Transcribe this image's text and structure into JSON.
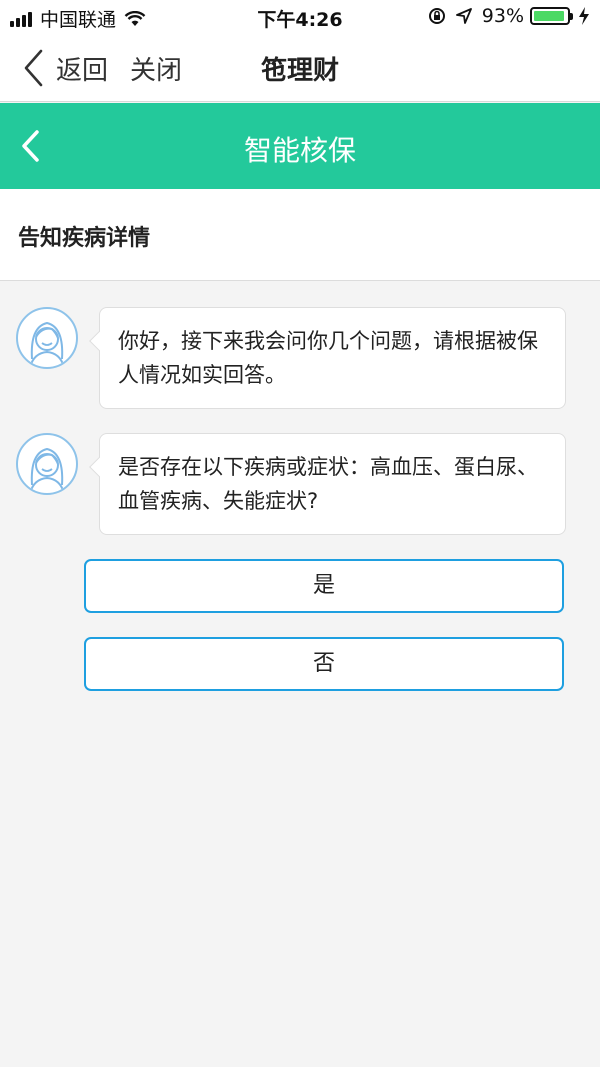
{
  "status_bar": {
    "carrier": "中国联通",
    "time": "下午4:26",
    "battery_percent": "93%",
    "battery_level": 0.93,
    "icons": [
      "signal-icon",
      "wifi-icon",
      "rotation-lock-icon",
      "location-icon",
      "battery-icon",
      "charging-icon"
    ]
  },
  "nav": {
    "back_label": "返回",
    "close_label": "关闭",
    "title": "竾理财"
  },
  "header": {
    "title": "智能核保",
    "accent_color": "#23c99b"
  },
  "section": {
    "title": "告知疾病详情"
  },
  "chat": {
    "messages": [
      {
        "text": "你好，接下来我会问你几个问题，请根据被保人情况如实回答。"
      },
      {
        "text": "是否存在以下疾病或症状：高血压、蛋白尿、血管疾病、失能症状?"
      }
    ]
  },
  "options": [
    {
      "label": "是"
    },
    {
      "label": "否"
    }
  ],
  "colors": {
    "option_border": "#1e9fe0",
    "avatar_border": "#8ec3ea",
    "background": "#f4f4f4"
  }
}
